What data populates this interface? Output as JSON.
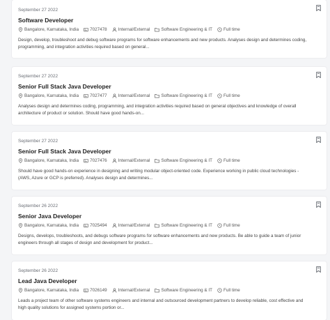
{
  "jobs": [
    {
      "date": "September 27 2022",
      "title": "Software Developer",
      "location": "Bangalore, Karnataka, India",
      "job_id": "7027478",
      "type": "Internal/External",
      "category": "Software Engineering & IT",
      "schedule": "Full time",
      "description": "Design, develop, troubleshoot and debug software programs for software enhancements and new products. Analyses design and determines coding, programming, and integration activities required based on general..."
    },
    {
      "date": "September 27 2022",
      "title": "Senior Full Stack Java Developer",
      "location": "Bangalore, Karnataka, India",
      "job_id": "7027477",
      "type": "Internal/External",
      "category": "Software Engineering & IT",
      "schedule": "Full time",
      "description": "Analyses design and determines coding, programming, and integration activities required based on general objectives and knowledge of overall architecture of product or solution. Should have good hands-on..."
    },
    {
      "date": "September 27 2022",
      "title": "Senior Full Stack Java Developer",
      "location": "Bangalore, Karnataka, India",
      "job_id": "7027476",
      "type": "Internal/External",
      "category": "Software Engineering & IT",
      "schedule": "Full time",
      "description": "Should have good hands-on experience in designing and writing modular object-oriented code. Experience working in public cloud technologies - (AWS, Azure or GCP is preferred). Analyses design and determines..."
    },
    {
      "date": "September 26 2022",
      "title": "Senior Java Developer",
      "location": "Bangalore, Karnataka, India",
      "job_id": "7025494",
      "type": "Internal/External",
      "category": "Software Engineering & IT",
      "schedule": "Full time",
      "description": "Designs, develops, troubleshoots, and debugs software programs for software enhancements and new products. Be able to guide a team of junior engineers through all stages of design and development for product..."
    },
    {
      "date": "September 26 2022",
      "title": "Lead Java Developer",
      "location": "Bangalore, Karnataka, India",
      "job_id": "7026149",
      "type": "Internal/External",
      "category": "Software Engineering & IT",
      "schedule": "Full time",
      "description": "Leads a project team of other software systems engineers and internal and outsourced development partners to develop reliable, cost effective and high quality solutions for assigned systems portion or..."
    }
  ],
  "icons": {
    "location": "map-pin-icon",
    "job_id": "id-card-icon",
    "type": "person-icon",
    "category": "folder-icon",
    "schedule": "clock-icon",
    "bookmark": "bookmark-icon"
  },
  "colors": {
    "card_bg": "#ffffff",
    "page_bg": "#f4f5f7",
    "title": "#222222",
    "text": "#444444"
  }
}
